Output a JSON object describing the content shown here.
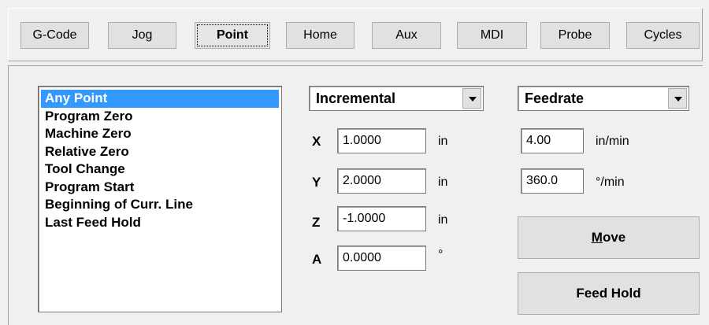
{
  "tabs": [
    {
      "label": "G-Code",
      "active": false
    },
    {
      "label": "Jog",
      "active": false
    },
    {
      "label": "Point",
      "active": true
    },
    {
      "label": "Home",
      "active": false
    },
    {
      "label": "Aux",
      "active": false
    },
    {
      "label": "MDI",
      "active": false
    },
    {
      "label": "Probe",
      "active": false
    },
    {
      "label": "Cycles",
      "active": false
    }
  ],
  "point_list": {
    "items": [
      "Any Point",
      "Program Zero",
      "Machine Zero",
      "Relative Zero",
      "Tool Change",
      "Program Start",
      "Beginning of Curr. Line",
      "Last Feed Hold"
    ],
    "selected": "Any Point"
  },
  "mode_select": {
    "value": "Incremental"
  },
  "rate_select": {
    "value": "Feedrate"
  },
  "axes": [
    {
      "label": "X",
      "value": "1.0000",
      "unit": "in"
    },
    {
      "label": "Y",
      "value": "2.0000",
      "unit": "in"
    },
    {
      "label": "Z",
      "value": "-1.0000",
      "unit": "in"
    },
    {
      "label": "A",
      "value": "0.0000",
      "unit": "°"
    }
  ],
  "rates": [
    {
      "value": "4.00",
      "unit": "in/min"
    },
    {
      "value": "360.0",
      "unit": "°/min"
    }
  ],
  "buttons": {
    "move_mnemonic": "M",
    "move_rest": "ove",
    "feed_hold": "Feed Hold"
  },
  "colors": {
    "selection": "#3399ff",
    "window_bg": "#f0f0f0",
    "button_face": "#e1e1e1"
  }
}
